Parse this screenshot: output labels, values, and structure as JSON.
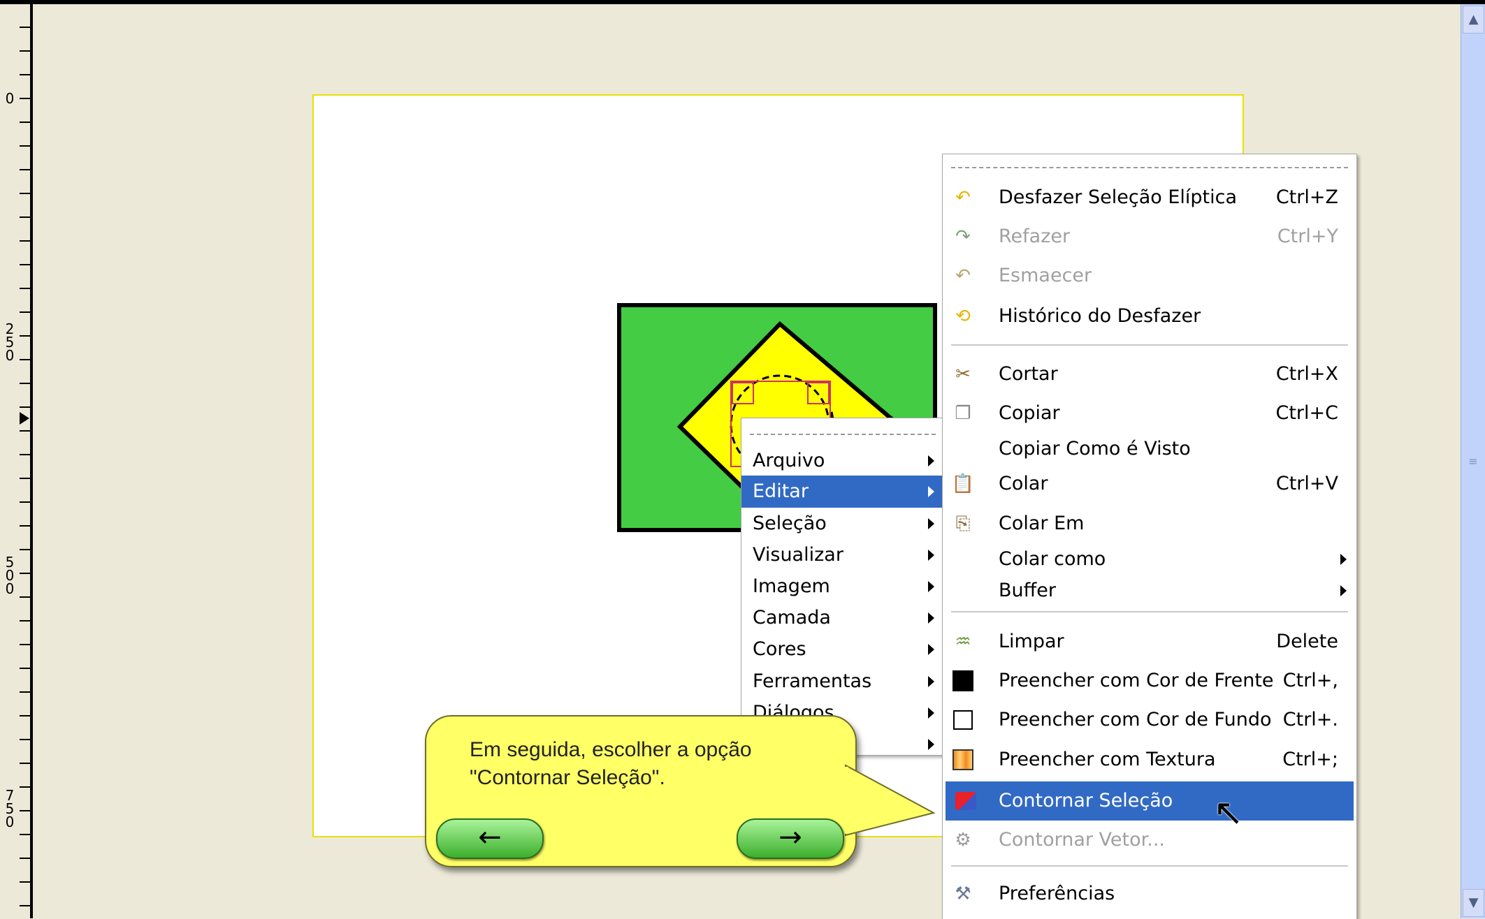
{
  "ruler": {
    "labels": [
      "0",
      "2\n5\n0",
      "5\n0\n0",
      "7\n5\n0"
    ]
  },
  "file_menu": {
    "items": [
      {
        "label": "Arquivo"
      },
      {
        "label": "Editar"
      },
      {
        "label": "Seleção"
      },
      {
        "label": "Visualizar"
      },
      {
        "label": "Imagem"
      },
      {
        "label": "Camada"
      },
      {
        "label": "Cores"
      },
      {
        "label": "Ferramentas"
      },
      {
        "label": "Diálogos"
      }
    ]
  },
  "edit_menu": {
    "items": [
      {
        "label": "Desfazer Seleção Elíptica",
        "shortcut": "Ctrl+Z",
        "icon": "undo-icon"
      },
      {
        "label": "Refazer",
        "shortcut": "Ctrl+Y",
        "icon": "redo-icon"
      },
      {
        "label": "Esmaecer",
        "icon": "fade-icon"
      },
      {
        "label": "Histórico do Desfazer",
        "icon": "undo-history-icon"
      },
      {
        "label": "Cortar",
        "shortcut": "Ctrl+X",
        "icon": "scissors-icon"
      },
      {
        "label": "Copiar",
        "shortcut": "Ctrl+C",
        "icon": "copy-icon"
      },
      {
        "label": "Copiar Como é Visto"
      },
      {
        "label": "Colar",
        "shortcut": "Ctrl+V",
        "icon": "paste-icon"
      },
      {
        "label": "Colar Em",
        "icon": "paste-into-icon"
      },
      {
        "label": "Colar como"
      },
      {
        "label": "Buffer"
      },
      {
        "label": "Limpar",
        "shortcut": "Delete",
        "icon": "clear-icon"
      },
      {
        "label": "Preencher com Cor de Frente",
        "shortcut": "Ctrl+,",
        "icon": "fill-foreground-icon"
      },
      {
        "label": "Preencher com Cor de Fundo",
        "shortcut": "Ctrl+.",
        "icon": "fill-background-icon"
      },
      {
        "label": "Preencher com Textura",
        "shortcut": "Ctrl+;",
        "icon": "fill-pattern-icon"
      },
      {
        "label": "Contornar Seleção",
        "icon": "stroke-selection-icon"
      },
      {
        "label": "Contornar Vetor...",
        "icon": "stroke-path-icon"
      },
      {
        "label": "Preferências",
        "icon": "preferences-icon"
      }
    ]
  },
  "tutorial": {
    "text": "Em seguida, escolher a opção \"Contornar Seleção\".",
    "prev_label": "←",
    "next_label": "→"
  },
  "colors": {
    "selection": "#316ac5",
    "flag_green": "#44cc44",
    "flag_yellow": "#ffff00",
    "bubble": "#ffff66"
  }
}
